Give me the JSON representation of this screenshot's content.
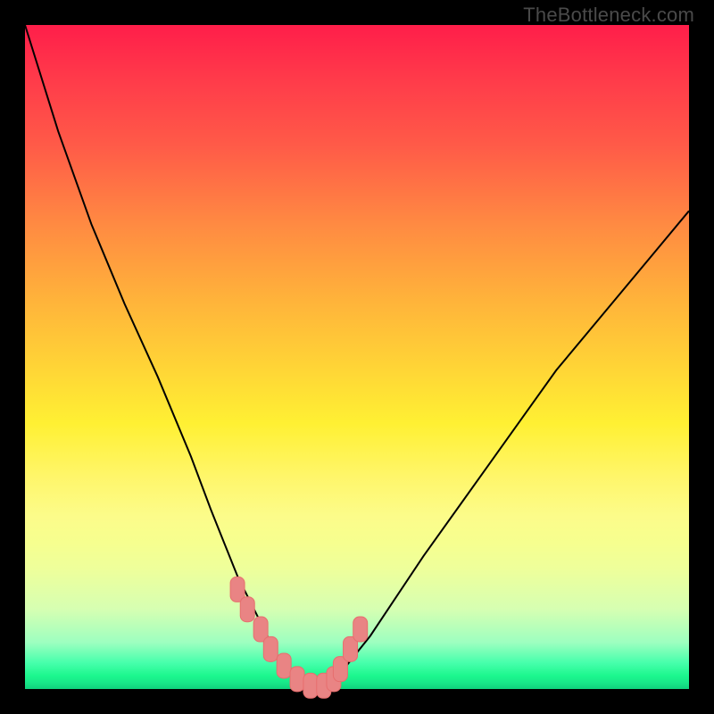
{
  "watermark": "TheBottleneck.com",
  "chart_data": {
    "type": "line",
    "title": "",
    "xlabel": "",
    "ylabel": "",
    "xlim": [
      0,
      100
    ],
    "ylim": [
      0,
      100
    ],
    "grid": false,
    "legend": false,
    "background_gradient": {
      "direction": "vertical",
      "stops": [
        {
          "pos": 0.0,
          "color": "#ff1e4a"
        },
        {
          "pos": 0.3,
          "color": "#ff8a42"
        },
        {
          "pos": 0.6,
          "color": "#fff033"
        },
        {
          "pos": 0.82,
          "color": "#eeff9b"
        },
        {
          "pos": 0.96,
          "color": "#48ffac"
        },
        {
          "pos": 1.0,
          "color": "#10d07d"
        }
      ]
    },
    "series": [
      {
        "name": "left-curve",
        "x": [
          0,
          5,
          10,
          15,
          20,
          25,
          28,
          30,
          32,
          34,
          36,
          38,
          40,
          42
        ],
        "y": [
          100,
          84,
          70,
          58,
          47,
          35,
          27,
          22,
          17,
          13,
          9,
          5,
          2,
          0
        ]
      },
      {
        "name": "right-curve",
        "x": [
          45,
          48,
          52,
          56,
          60,
          65,
          70,
          75,
          80,
          85,
          90,
          95,
          100
        ],
        "y": [
          0,
          3,
          8,
          14,
          20,
          27,
          34,
          41,
          48,
          54,
          60,
          66,
          72
        ]
      }
    ],
    "markers": {
      "name": "bottom-markers",
      "shape": "rounded-rect",
      "color": "#e98484",
      "x": [
        32.0,
        33.5,
        35.5,
        37.0,
        39.0,
        41.0,
        43.0,
        45.0,
        46.5,
        47.5,
        49.0,
        50.5
      ],
      "y": [
        15.0,
        12.0,
        9.0,
        6.0,
        3.5,
        1.5,
        0.5,
        0.5,
        1.5,
        3.0,
        6.0,
        9.0
      ]
    }
  }
}
